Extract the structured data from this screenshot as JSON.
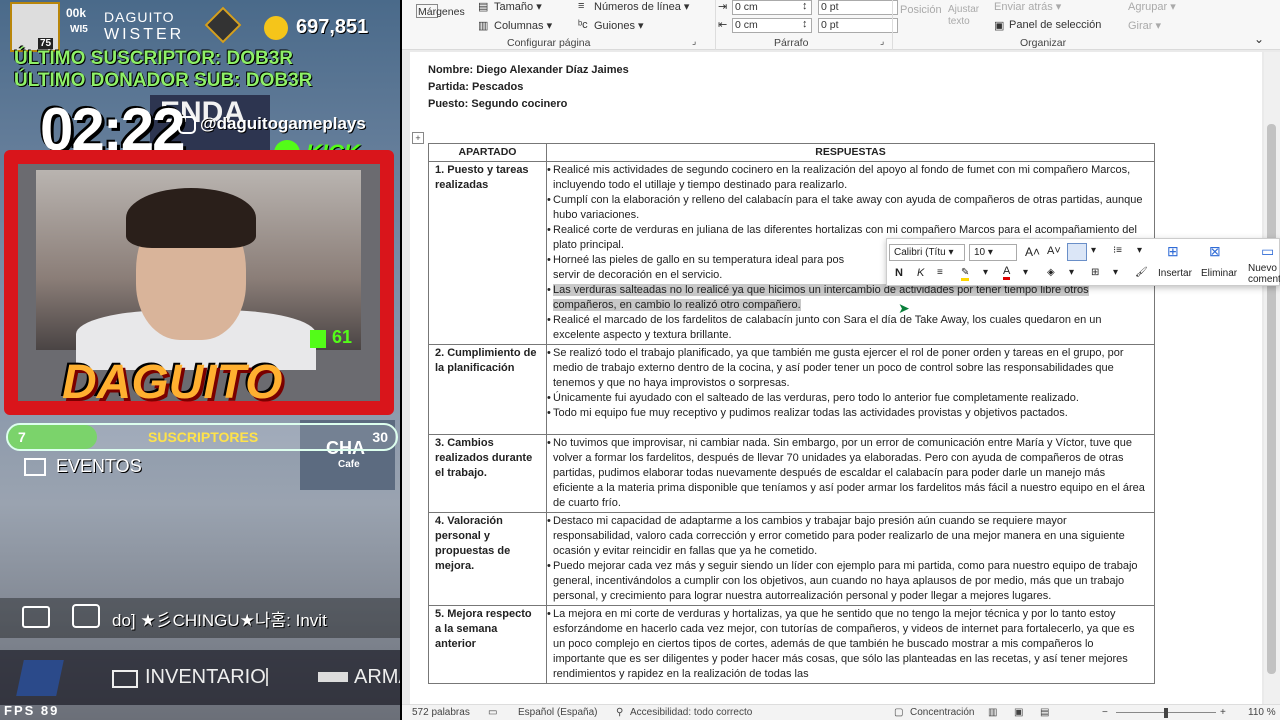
{
  "stream": {
    "level": "75",
    "avatar_tag": "00k",
    "avatar_sub": "WI5",
    "username": "DAGUITO",
    "clan": "WISTER",
    "coins": "697,851",
    "last_sub": "ÚLTIMO SUSCRIPTOR: DOB3R",
    "last_donor": "ÚLTIMO DONADOR SUB: DOB3R",
    "timer": "02:22",
    "instagram": "@daguitogameplays",
    "kick": "KICK",
    "kick_count": "61",
    "streamer_name": "DAGUITO",
    "sub_goal": {
      "current": "7",
      "label": "SUSCRIPTORES",
      "target": "30",
      "fraction": 0.23
    },
    "events": "EVENTOS",
    "chat_message": "do] ★彡CHINGU★나홈: Invit",
    "inventory": "INVENTARIO",
    "arma": "ARMA",
    "fps": "FPS   89",
    "bg_text": "ENDA",
    "bg_text2": "CHA",
    "bg_text3": "Cafe"
  },
  "ribbon": {
    "margins": "Márgenes",
    "size": "Tamaño",
    "columns": "Columnas",
    "line_numbers": "Números de línea",
    "hyphenation": "Guiones",
    "group_page": "Configurar página",
    "indent_left": "0 cm",
    "indent_right": "0 cm",
    "space_before": "0 pt",
    "space_after": "0 pt",
    "group_paragraph": "Párrafo",
    "position": "Posición",
    "wrap_text": "Ajustar texto",
    "send_back": "Enviar atrás",
    "selection_pane": "Panel de selección",
    "group": "Agrupar",
    "rotate": "Girar",
    "group_arrange": "Organizar"
  },
  "doc": {
    "name_line": "Nombre: Diego Alexander Díaz Jaimes",
    "partida_line": "Partida: Pescados",
    "puesto_line": "Puesto: Segundo cocinero",
    "col1": "APARTADO",
    "col2": "RESPUESTAS",
    "rows": [
      {
        "label": "1. Puesto y tareas realizadas",
        "items": [
          "Realicé mis actividades de segundo cocinero en la realización del apoyo al fondo de fumet con mi compañero Marcos, incluyendo todo el utillaje y tiempo destinado para realizarlo.",
          "Cumplí con la elaboración y relleno del calabacín para el take away con ayuda de compañeros de otras partidas, aunque hubo variaciones.",
          "Realicé corte de verduras en juliana de las diferentes hortalizas con mi compañero Marcos para el acompañamiento del plato principal.",
          "Horneé las pieles de gallo en su temperatura ideal para pos",
          "servir de decoración en el servicio.",
          "Las verduras salteadas no lo realicé ya que hicimos un intercambio de actividades por tener tiempo libre otros compañeros, en cambio lo realizó otro compañero.",
          "Realicé el marcado de los fardelitos de calabacín junto con Sara el día de Take Away, los cuales quedaron en un excelente aspecto y textura brillante."
        ]
      },
      {
        "label": "2. Cumplimiento de la planificación",
        "items": [
          "Se realizó todo el trabajo planificado, ya que también me gusta ejercer el rol de poner orden y tareas en el grupo, por medio de trabajo externo dentro de la cocina, y así poder tener un poco de control sobre las responsabilidades que tenemos y que no haya improvistos o sorpresas.",
          "Únicamente fui ayudado con el salteado de las verduras, pero todo lo anterior fue completamente realizado.",
          "Todo mi equipo fue muy receptivo y pudimos realizar todas las actividades provistas y objetivos pactados."
        ]
      },
      {
        "label": "3. Cambios realizados durante el trabajo.",
        "items": [
          "No tuvimos que improvisar, ni cambiar nada. Sin embargo, por un error de comunicación entre María y Víctor, tuve que volver a formar los fardelitos, después de llevar 70 unidades ya elaboradas. Pero con ayuda de compañeros de otras partidas, pudimos elaborar todas nuevamente después de escaldar el calabacín para poder darle un manejo más eficiente a la materia prima disponible que teníamos y así poder armar los fardelitos más fácil a nuestro equipo en el área de cuarto frío."
        ]
      },
      {
        "label": "4. Valoración personal y propuestas de mejora.",
        "items": [
          "Destaco mi capacidad de adaptarme a los cambios y trabajar bajo presión aún cuando se requiere mayor responsabilidad, valoro cada corrección y error cometido para poder realizarlo de una mejor manera en una siguiente ocasión y evitar reincidir en fallas que ya he cometido.",
          " Puedo mejorar cada vez más y seguir siendo un líder con ejemplo para mi partida, como para nuestro equipo de trabajo general, incentivándolos a cumplir con los objetivos, aun cuando no haya aplausos de por medio, más que un trabajo personal, y crecimiento para lograr nuestra autorrealización personal y poder llegar a mejores lugares."
        ]
      },
      {
        "label": "5. Mejora respecto a la semana anterior",
        "items": [
          "La mejora en mi corte de verduras y hortalizas, ya que he sentido que no tengo la mejor técnica y por lo tanto estoy esforzándome en hacerlo cada vez mejor, con tutorías de compañeros, y videos de internet para fortalecerlo, ya que es un poco complejo en ciertos tipos de cortes, además de que también he buscado mostrar a mis compañeros lo importante que es ser diligentes y poder hacer más cosas, que sólo las planteadas en las recetas, y así tener mejores rendimientos y rapidez en la realización de todas las"
        ]
      }
    ]
  },
  "minitoolbar": {
    "font": "Calibri (Títu",
    "size": "10",
    "bold": "N",
    "italic": "K",
    "insert": "Insertar",
    "delete": "Eliminar",
    "new_comment": "Nuevo comentario"
  },
  "status": {
    "words": "572 palabras",
    "language": "Español (España)",
    "accessibility": "Accesibilidad: todo correcto",
    "focus": "Concentración",
    "zoom": "110 %"
  }
}
